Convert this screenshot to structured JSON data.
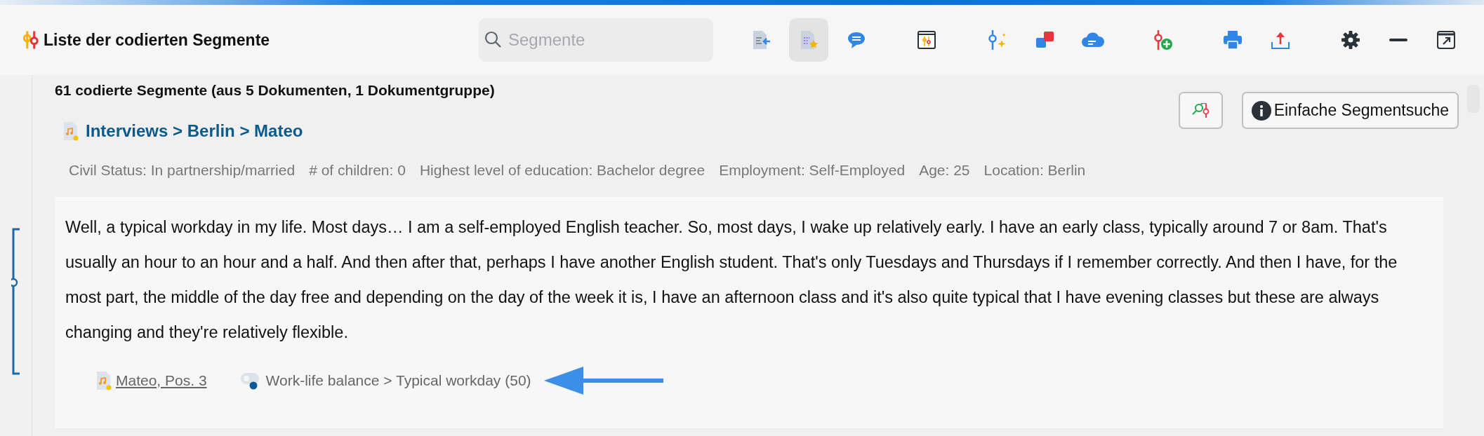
{
  "window": {
    "title": "Liste der codierten Segmente"
  },
  "search": {
    "placeholder": "Segmente"
  },
  "toolbar_groups": [
    {
      "items": [
        {
          "kind": "doc-arrow",
          "selected": false
        },
        {
          "kind": "doc-star",
          "selected": true
        },
        {
          "kind": "comment",
          "selected": false
        }
      ]
    },
    {
      "items": [
        {
          "kind": "panel",
          "selected": false
        }
      ]
    },
    {
      "items": [
        {
          "kind": "code-spark",
          "selected": false
        },
        {
          "kind": "squares",
          "selected": false
        },
        {
          "kind": "cloud",
          "selected": false
        }
      ]
    },
    {
      "items": [
        {
          "kind": "code-add",
          "selected": false
        }
      ]
    },
    {
      "items": [
        {
          "kind": "print",
          "selected": false
        },
        {
          "kind": "export",
          "selected": false
        }
      ]
    },
    {
      "items": [
        {
          "kind": "settings",
          "selected": false
        },
        {
          "kind": "minimize",
          "selected": false
        },
        {
          "kind": "popout",
          "selected": false
        }
      ]
    }
  ],
  "summary": "61 codierte Segmente (aus 5 Dokumenten, 1 Dokumentgruppe)",
  "buttons": [
    {
      "kind": "icon"
    },
    {
      "kind": "info",
      "label": "Einfache Segmentsuche"
    }
  ],
  "document": {
    "path": "Interviews > Berlin > Mateo"
  },
  "attributes": [
    "Civil Status: In partnership/married",
    "# of children: 0",
    "Highest level of education: Bachelor degree",
    "Employment: Self-Employed",
    "Age: 25",
    "Location: Berlin"
  ],
  "segment": {
    "text": "Well, a typical workday in my life. Most days… I am a self-employed English teacher. So, most days, I wake up relatively early. I have an early class, typically around 7 or 8am. That's usually an hour to an hour and a half. And then after that, perhaps I have another English student. That's only Tuesdays and Thursdays if I remember correctly. And then I have, for the most part, the middle of the day free and depending on the day of the week it is, I have an afternoon class and it's also quite typical that I have evening classes but these are always changing and they're relatively flexible.",
    "source": "Mateo, Pos. 3",
    "code": "Work-life balance > Typical workday (50)"
  }
}
